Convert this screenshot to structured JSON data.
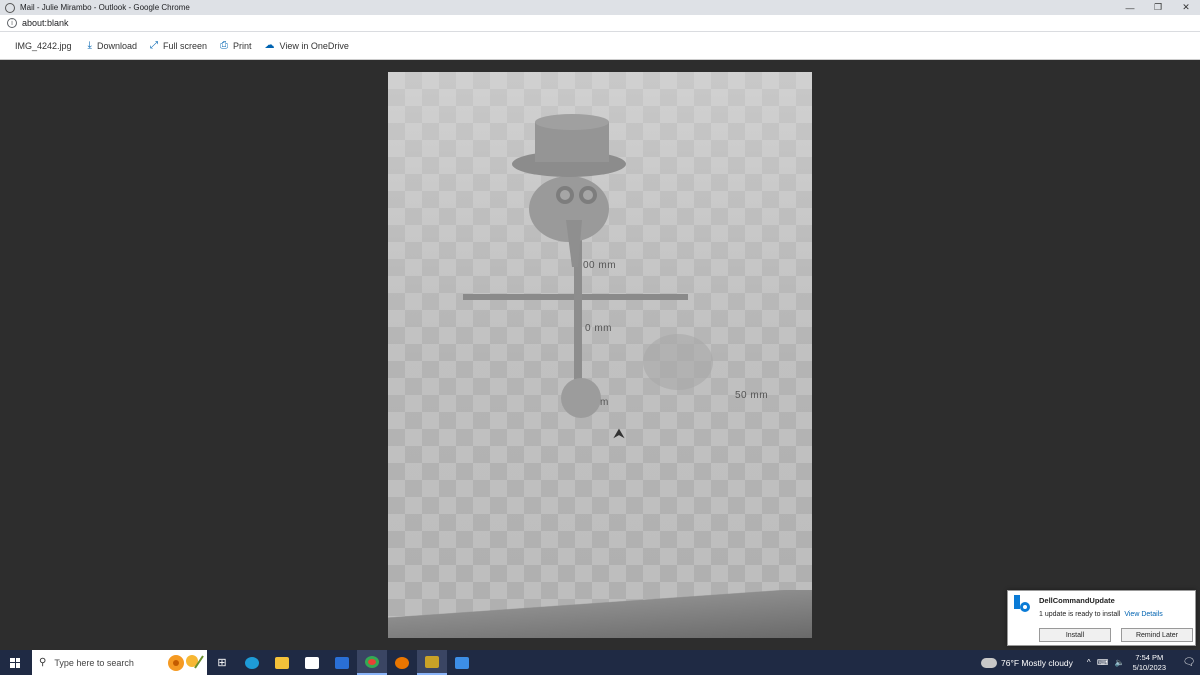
{
  "window": {
    "title": "Mail - Julie Mirambo - Outlook - Google Chrome",
    "controls": {
      "minimize": "—",
      "restore": "❐",
      "close": "✕"
    }
  },
  "address": {
    "url": "about:blank"
  },
  "toolbar": {
    "filename": "IMG_4242.jpg",
    "download": "Download",
    "fullscreen": "Full screen",
    "print": "Print",
    "onedrive": "View in OneDrive"
  },
  "photo": {
    "labels": {
      "top": "00 mm",
      "mid": "0 mm",
      "lower": "m",
      "right": "50 mm"
    }
  },
  "toast": {
    "app": "DellCommandUpdate",
    "message": "1 update is ready to install",
    "link": "View Details",
    "install": "Install",
    "remind": "Remind Later"
  },
  "taskbar": {
    "search_placeholder": "Type here to search",
    "weather": "76°F  Mostly cloudy",
    "time": "7:54 PM",
    "date": "5/10/2023"
  }
}
